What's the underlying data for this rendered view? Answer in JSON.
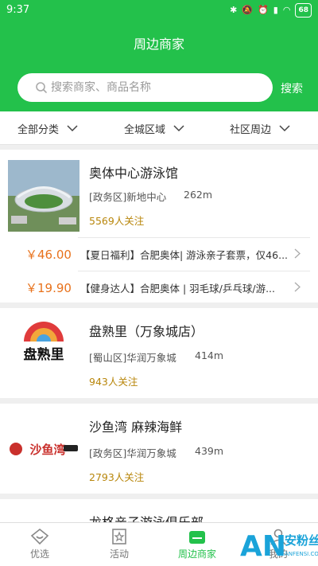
{
  "status": {
    "time": "9:37",
    "battery": "68"
  },
  "header": {
    "title": "周边商家",
    "search_placeholder": "搜索商家、商品名称",
    "search_button": "搜索"
  },
  "filters": [
    "全部分类",
    "全城区域",
    "社区周边"
  ],
  "shops": [
    {
      "name": "奥体中心游泳馆",
      "location": "[政务区]新地中心",
      "distance": "262m",
      "followers": "5569人关注",
      "deals": [
        {
          "price": "￥46.00",
          "text": "【夏日福利】合肥奥体| 游泳亲子套票，仅46..."
        },
        {
          "price": "￥19.90",
          "text": "【健身达人】合肥奥体 | 羽毛球/乒乓球/游..."
        }
      ]
    },
    {
      "name": "盘熟里（万象城店）",
      "location": "[蜀山区]华润万象城",
      "distance": "414m",
      "followers": "943人关注",
      "logo_text": "盘熟里"
    },
    {
      "name": "沙鱼湾 麻辣海鲜",
      "location": "[政务区]华润万象城",
      "distance": "439m",
      "followers": "2793人关注",
      "logo_text": "沙鱼湾"
    },
    {
      "name": "龙格亲子游泳俱乐部"
    }
  ],
  "nav": [
    {
      "label": "优选",
      "icon": "heart-diamond-icon"
    },
    {
      "label": "活动",
      "icon": "star-bookmark-icon"
    },
    {
      "label": "周边商家",
      "icon": "shop-icon",
      "active": true
    },
    {
      "label": "我的",
      "icon": "person-icon"
    }
  ],
  "watermark": {
    "text": "安粉丝",
    "sub": "ANFENSI.COM"
  },
  "colors": {
    "brand_green": "#23c14b",
    "price_orange": "#e8721c",
    "follow_gold": "#b8860b"
  }
}
